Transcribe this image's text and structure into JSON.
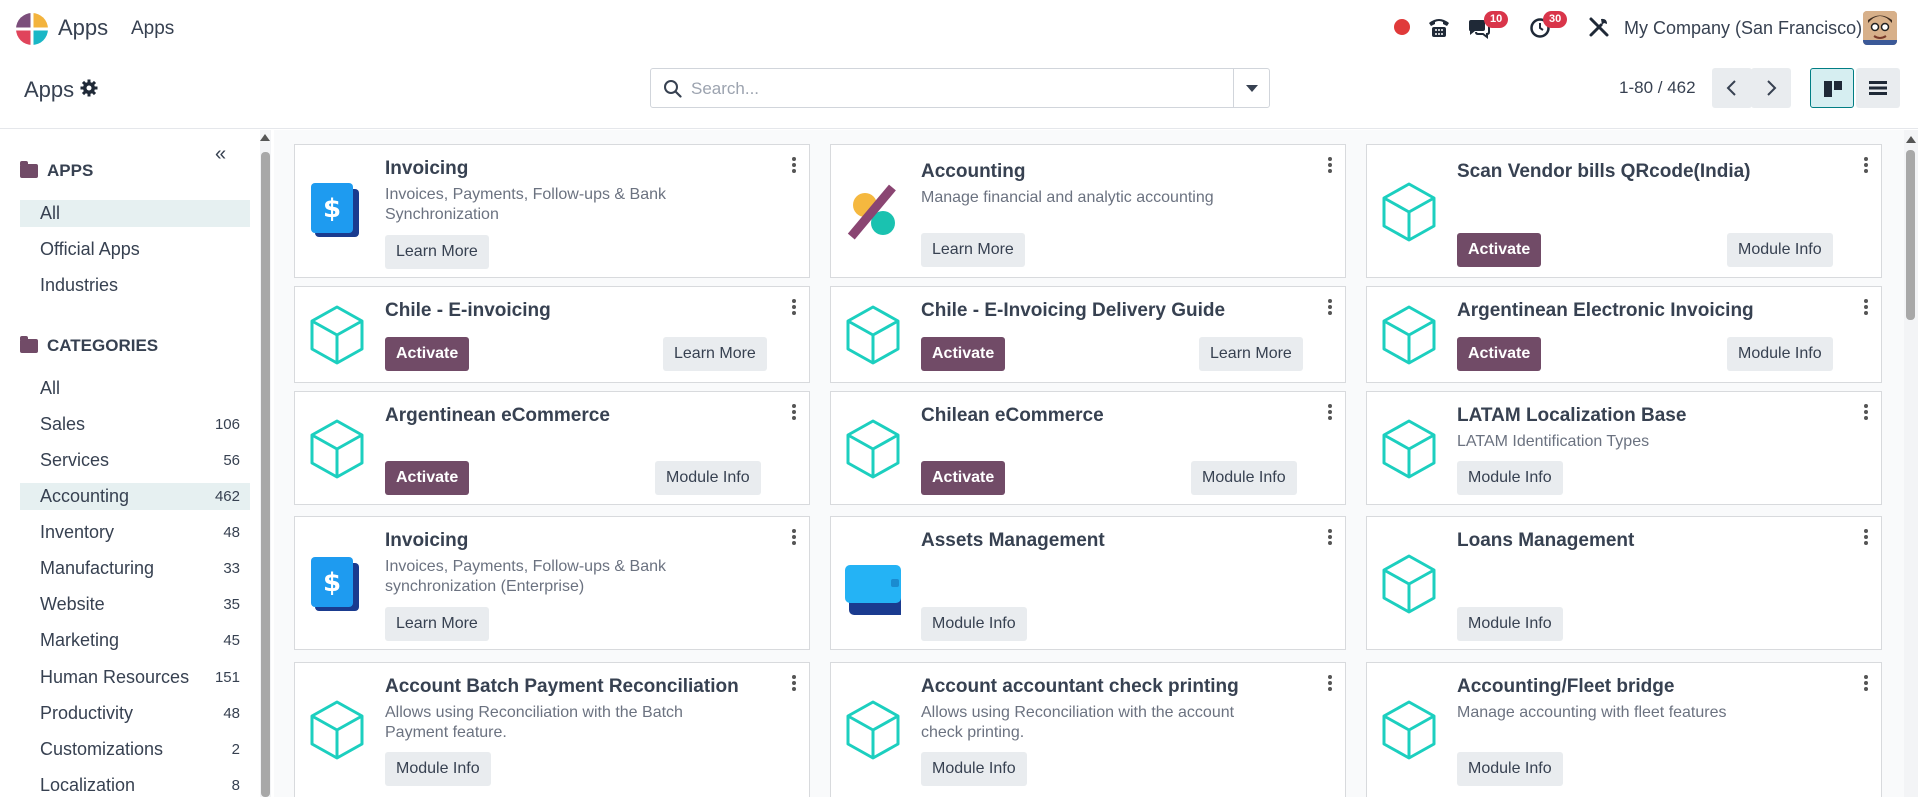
{
  "navbar": {
    "brand": "Apps",
    "menu": "Apps",
    "company": "My Company (San Francisco)",
    "messages_badge": "10",
    "activities_badge": "30",
    "colors": {
      "primary": "#714b67",
      "badge": "#d9354a",
      "record": "#e03a3a"
    }
  },
  "control": {
    "title": "Apps",
    "search_placeholder": "Search...",
    "pager": "1-80 / 462"
  },
  "sidebar": {
    "apps_header": "APPS",
    "apps_items": [
      {
        "label": "All"
      },
      {
        "label": "Official Apps"
      },
      {
        "label": "Industries"
      }
    ],
    "categories_header": "CATEGORIES",
    "categories": [
      {
        "label": "All",
        "count": ""
      },
      {
        "label": "Sales",
        "count": "106"
      },
      {
        "label": "Services",
        "count": "56"
      },
      {
        "label": "Accounting",
        "count": "462"
      },
      {
        "label": "Inventory",
        "count": "48"
      },
      {
        "label": "Manufacturing",
        "count": "33"
      },
      {
        "label": "Website",
        "count": "35"
      },
      {
        "label": "Marketing",
        "count": "45"
      },
      {
        "label": "Human Resources",
        "count": "151"
      },
      {
        "label": "Productivity",
        "count": "48"
      },
      {
        "label": "Customizations",
        "count": "2"
      },
      {
        "label": "Localization",
        "count": "8"
      }
    ]
  },
  "cards": [
    {
      "title": "Invoicing",
      "desc": "Invoices, Payments, Follow-ups & Bank Synchronization",
      "icon": "invoicing-icon",
      "left_btn": "Learn More",
      "right_btn": ""
    },
    {
      "title": "Accounting",
      "desc": "Manage financial and analytic accounting",
      "icon": "accounting-icon",
      "left_btn": "Learn More",
      "right_btn": ""
    },
    {
      "title": "Scan Vendor bills QRcode(India)",
      "desc": "",
      "icon": "module-cube-icon",
      "left_btn": "Activate",
      "right_btn": "Module Info"
    },
    {
      "title": "Chile - E-invoicing",
      "desc": "",
      "icon": "module-cube-icon",
      "left_btn": "Activate",
      "right_btn": "Learn More"
    },
    {
      "title": "Chile - E-Invoicing Delivery Guide",
      "desc": "",
      "icon": "module-cube-icon",
      "left_btn": "Activate",
      "right_btn": "Learn More"
    },
    {
      "title": "Argentinean Electronic Invoicing",
      "desc": "",
      "icon": "module-cube-icon",
      "left_btn": "Activate",
      "right_btn": "Module Info"
    },
    {
      "title": "Argentinean eCommerce",
      "desc": "",
      "icon": "module-cube-icon",
      "left_btn": "Activate",
      "right_btn": "Module Info"
    },
    {
      "title": "Chilean eCommerce",
      "desc": "",
      "icon": "module-cube-icon",
      "left_btn": "Activate",
      "right_btn": "Module Info"
    },
    {
      "title": "LATAM Localization Base",
      "desc": "LATAM Identification Types",
      "icon": "module-cube-icon",
      "left_btn": "Module Info",
      "right_btn": ""
    },
    {
      "title": "Invoicing",
      "desc": "Invoices, Payments, Follow-ups & Bank synchronization (Enterprise)",
      "icon": "invoicing-icon",
      "left_btn": "Learn More",
      "right_btn": ""
    },
    {
      "title": "Assets Management",
      "desc": "",
      "icon": "wallet-icon",
      "left_btn": "Module Info",
      "right_btn": ""
    },
    {
      "title": "Loans Management",
      "desc": "",
      "icon": "module-cube-icon",
      "left_btn": "Module Info",
      "right_btn": ""
    },
    {
      "title": "Account Batch Payment Reconciliation",
      "desc": "Allows using Reconciliation with the Batch Payment feature.",
      "icon": "module-cube-icon",
      "left_btn": "Module Info",
      "right_btn": ""
    },
    {
      "title": "Account accountant check printing",
      "desc": "Allows using Reconciliation with the account check printing.",
      "icon": "module-cube-icon",
      "left_btn": "Module Info",
      "right_btn": ""
    },
    {
      "title": "Accounting/Fleet bridge",
      "desc": "Manage accounting with fleet features",
      "icon": "module-cube-icon",
      "left_btn": "Module Info",
      "right_btn": ""
    }
  ]
}
